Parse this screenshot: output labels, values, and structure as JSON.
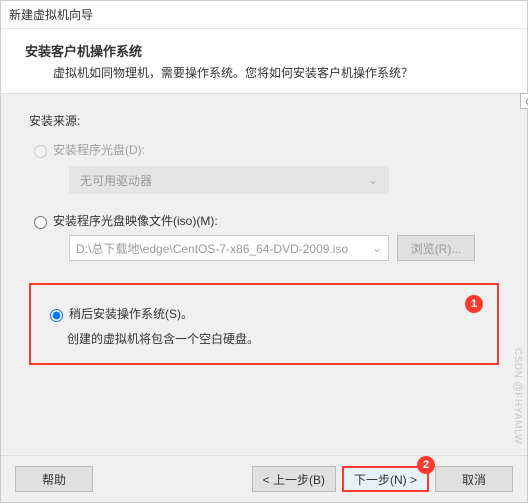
{
  "window": {
    "title": "新建虚拟机向导"
  },
  "header": {
    "title": "安装客户机操作系统",
    "subtitle": "虚拟机如同物理机，需要操作系统。您将如何安装客户机操作系统？"
  },
  "source": {
    "label": "安装来源:",
    "disc": {
      "label": "安装程序光盘(D):",
      "dropdown_value": "无可用驱动器"
    },
    "iso": {
      "label": "安装程序光盘映像文件(iso)(M):",
      "path": "D:\\总下载地\\edge\\CentOS-7-x86_64-DVD-2009.iso",
      "browse": "浏览(R)..."
    },
    "later": {
      "label": "稍后安装操作系统(S)。",
      "desc": "创建的虚拟机将包含一个空白硬盘。"
    }
  },
  "annotations": {
    "one": "1",
    "two": "2"
  },
  "footer": {
    "help": "帮助",
    "back": "< 上一步(B)",
    "next": "下一步(N) >",
    "cancel": "取消"
  },
  "side_glyph": "〈",
  "watermark": "CSDN @FHYAMLW"
}
